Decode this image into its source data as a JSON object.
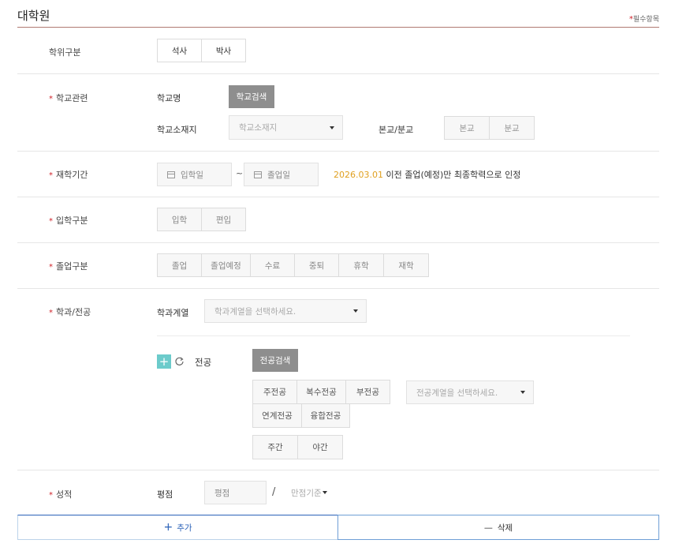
{
  "header": {
    "title": "대학원",
    "required_note": "필수항목",
    "required_mark": "*"
  },
  "degree": {
    "label": "학위구분",
    "options": [
      "석사",
      "박사"
    ]
  },
  "school": {
    "label": "학교관련",
    "name_label": "학교명",
    "search_button": "학교검색",
    "location_label": "학교소재지",
    "location_placeholder": "학교소재지",
    "campus_label": "본교/분교",
    "campus_options": [
      "본교",
      "분교"
    ]
  },
  "period": {
    "label": "재학기간",
    "start_placeholder": "입학일",
    "separator": "~",
    "end_placeholder": "졸업일",
    "note_date": "2026.03.01",
    "note_text": "이전 졸업(예정)만 최종학력으로 인정"
  },
  "admission": {
    "label": "입학구분",
    "options": [
      "입학",
      "편입"
    ]
  },
  "graduation": {
    "label": "졸업구분",
    "options": [
      "졸업",
      "졸업예정",
      "수료",
      "중퇴",
      "휴학",
      "재학"
    ]
  },
  "major": {
    "label": "학과/전공",
    "dept_label": "학과계열",
    "dept_placeholder": "학과계열을 선택하세요.",
    "major_label": "전공",
    "search_button": "전공검색",
    "major_types": [
      "주전공",
      "복수전공",
      "부전공",
      "연계전공",
      "융합전공"
    ],
    "major_select_placeholder": "전공계열을 선택하세요.",
    "time_options": [
      "주간",
      "야간"
    ]
  },
  "grade": {
    "label": "성적",
    "gpa_label": "평점",
    "gpa_placeholder": "평점",
    "slash": "/",
    "scale_placeholder": "만점기준"
  },
  "actions": {
    "add_label": "추가",
    "add_icon": "+",
    "delete_label": "삭제",
    "delete_icon": "—"
  },
  "colors": {
    "accent_red": "#d0232b",
    "note_orange": "#e0a020",
    "add_blue": "#2b62b8",
    "teal": "#6ccbcb"
  }
}
